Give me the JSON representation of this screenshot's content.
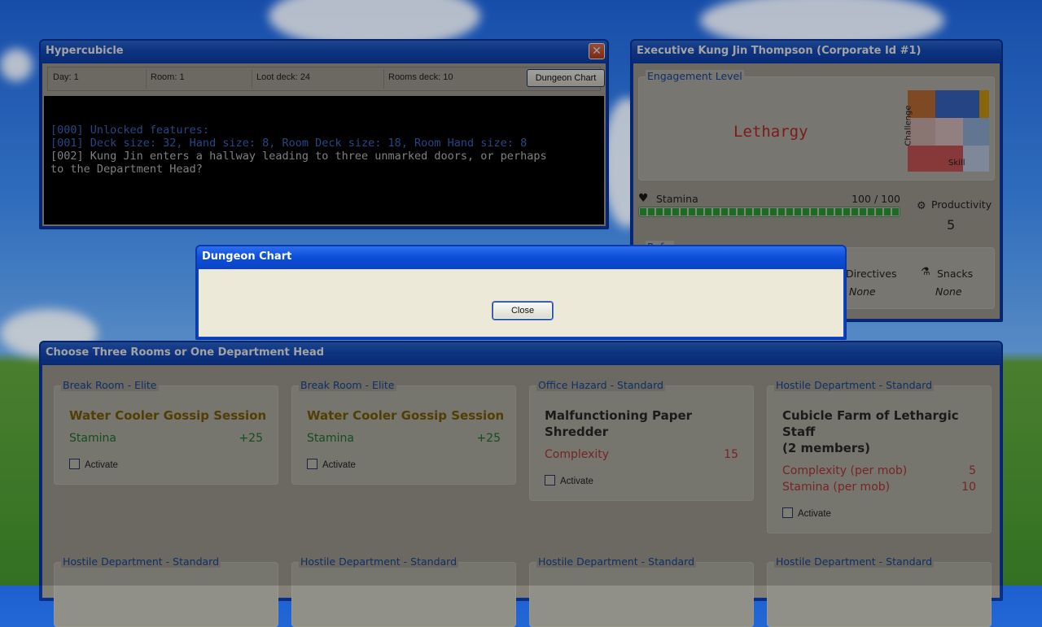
{
  "hypercubicle": {
    "title": "Hypercubicle",
    "close_glyph": "✕",
    "status": {
      "day": "Day: 1",
      "room": "Room: 1",
      "loot_deck": "Loot deck: 24",
      "rooms_deck": "Rooms deck: 10",
      "dungeon_chart_button": "Dungeon Chart"
    },
    "log": [
      "[000] Unlocked features:",
      "[001] Deck size: 32, Hand size: 8, Room Deck size: 18, Room Hand size: 8",
      "[002] Kung Jin enters a hallway leading to three unmarked doors, or perhaps",
      "to the Department Head?"
    ]
  },
  "executive": {
    "title": "Executive Kung Jin Thompson (Corporate Id #1)",
    "engagement_legend": "Engagement Level",
    "engagement_value": "Lethargy",
    "matrix_labels": {
      "y": "Challenge",
      "x": "Skill"
    },
    "stamina_label": "Stamina",
    "stamina_value": "100 / 100",
    "stamina_fraction": 1.0,
    "productivity_label": "Productivity",
    "productivity_value": "5",
    "partial_legend": "Ref...",
    "directives_label": "Directives",
    "directives_value": "None",
    "snacks_label": "Snacks",
    "snacks_value": "None"
  },
  "dialog": {
    "title": "Dungeon Chart",
    "close_label": "Close"
  },
  "rooms": {
    "title": "Choose Three Rooms or One Department Head",
    "activate_label": "Activate",
    "cards": [
      {
        "legend": "Break Room - Elite",
        "title": "Water Cooler Gossip Session",
        "stats": [
          {
            "label": "Stamina",
            "value": "+25"
          }
        ]
      },
      {
        "legend": "Break Room - Elite",
        "title": "Water Cooler Gossip Session",
        "stats": [
          {
            "label": "Stamina",
            "value": "+25"
          }
        ]
      },
      {
        "legend": "Office Hazard - Standard",
        "title_line1": "Malfunctioning Paper",
        "title_line2": "Shredder",
        "stats": [
          {
            "label": "Complexity",
            "value": "15"
          }
        ]
      },
      {
        "legend": "Hostile Department - Standard",
        "title_line1": "Cubicle Farm of Lethargic",
        "title_line2": "Staff",
        "title_line3": "(2 members)",
        "stats": [
          {
            "label": "Complexity (per mob)",
            "value": "5"
          },
          {
            "label": "Stamina (per mob)",
            "value": "10"
          }
        ]
      }
    ],
    "bottom_legends": [
      "Hostile Department - Standard",
      "Hostile Department - Standard",
      "Hostile Department - Standard",
      "Hostile Department - Standard"
    ]
  }
}
